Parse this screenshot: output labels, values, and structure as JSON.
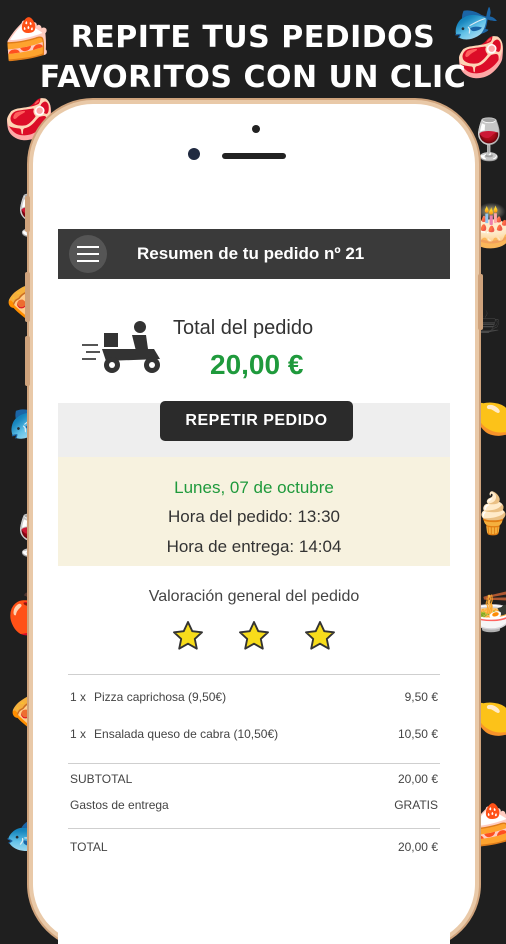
{
  "headline": {
    "line1": "REPITE TUS PEDIDOS",
    "line2": "FAVORITOS CON UN CLIC"
  },
  "background_icons": [
    "cake-icon",
    "fish-icon",
    "steak-icon",
    "wine-glass-icon",
    "birthday-cake-icon",
    "coffee-cup-icon",
    "lemon-slice-icon",
    "fish-icon",
    "ice-cream-icon",
    "apple-icon",
    "noodles-icon",
    "pizza-icon"
  ],
  "app": {
    "title": "Resumen de tu pedido nº 21",
    "menu_icon": "hamburger-menu-icon"
  },
  "order": {
    "total_label": "Total del pedido",
    "total_value": "20,00 €",
    "repeat_button": "REPETIR PEDIDO",
    "delivery_icon": "delivery-scooter-icon"
  },
  "schedule": {
    "date": "Lunes, 07 de octubre",
    "order_time": "Hora del pedido: 13:30",
    "delivery_time": "Hora de entrega: 14:04"
  },
  "rating": {
    "label": "Valoración general del pedido",
    "stars": 3,
    "max_stars": 3
  },
  "items": [
    {
      "qty": "1 x",
      "name": "Pizza caprichosa (9,50€)",
      "price": "9,50 €"
    },
    {
      "qty": "1 x",
      "name": "Ensalada queso de cabra (10,50€)",
      "price": "10,50 €"
    }
  ],
  "summary": {
    "subtotal_label": "SUBTOTAL",
    "subtotal_value": "20,00 €",
    "shipping_label": "Gastos de entrega",
    "shipping_value": "GRATIS",
    "total_label": "TOTAL",
    "total_value": "20,00 €"
  },
  "colors": {
    "accent_green": "#1f9a3c",
    "star_yellow": "#f7dc1b",
    "appbar": "#3a3a3a",
    "date_band": "#f7f2df"
  }
}
